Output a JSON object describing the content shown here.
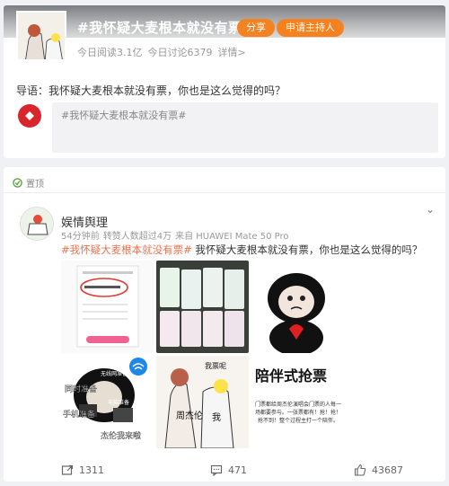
{
  "topic": {
    "title": "#我怀疑大麦根本就没有票#",
    "share_label": "分享",
    "host_label": "申请主持人",
    "stats": {
      "reads": "今日阅读3.1亿",
      "discussions": "今日讨论6379",
      "details": "详情>"
    },
    "intro": "导语：我怀疑大麦根本就没有票，你也是这么觉得的吗？",
    "post_box_text": "#我怀疑大麦根本就没有票#"
  },
  "feed": {
    "tag_label": "置顶",
    "author": "娱情舆理",
    "meta": {
      "time": "54分钟前",
      "endorse": "转赞人数超过4万",
      "source": "来自 HUAWEI Mate 50 Pro"
    },
    "text": {
      "hashtag": "#我怀疑大麦根本就没有票#",
      "body": " 我怀疑大麦根本就没有票，你也是这么觉得的吗？"
    },
    "images": {
      "meme3_text1": "同时准备",
      "meme3_text2": "手机准备",
      "meme3_text3": "电脑准备",
      "meme3_text4": "杰伦我来啦",
      "meme3_text5": "无线网准备",
      "meme4_text1": "我票呢",
      "meme4_text2": "周杰伦",
      "meme4_text3": "我",
      "meme5_title": "陪伴式抢票",
      "meme5_body": "门票都给周杰伦演唱会门票的人每一场都要参与。一张票都有！抢！抢！抢不到！整个过程主打一个陪伴。"
    },
    "actions": {
      "share_count": "1311",
      "comment_count": "471",
      "like_count": "43687"
    }
  },
  "colors": {
    "accent": "#f58220",
    "hashtag": "#eb7350",
    "tag_green": "#5aa43a"
  }
}
